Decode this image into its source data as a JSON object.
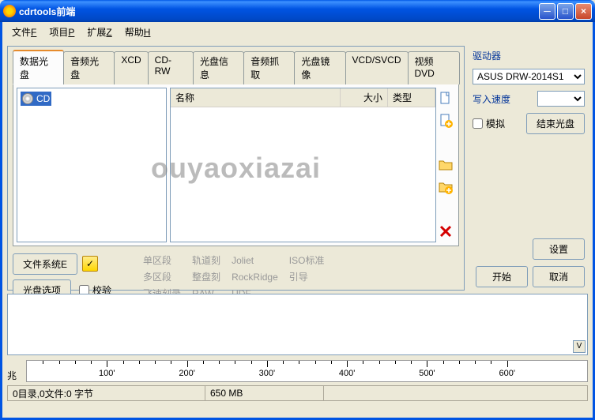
{
  "titlebar": {
    "title": "cdrtools前端"
  },
  "menu": {
    "file": "文件",
    "file_u": "F",
    "project": "项目",
    "project_u": "P",
    "extend": "扩展",
    "extend_u": "Z",
    "help": "帮助",
    "help_u": "H"
  },
  "tabs": [
    "数据光盘",
    "音频光盘",
    "XCD",
    "CD-RW",
    "光盘信息",
    "音频抓取",
    "光盘镜像",
    "VCD/SVCD",
    "视频DVD"
  ],
  "active_tab": 0,
  "tree": {
    "root": "CD"
  },
  "listcols": {
    "name": "名称",
    "size": "大小",
    "type": "类型"
  },
  "buttons": {
    "filesystem": "文件系统E",
    "discoptions": "光盘选项",
    "verify": "校验",
    "settings": "设置",
    "start": "开始",
    "cancel": "取消",
    "finalize": "结束光盘"
  },
  "info": {
    "r1c1": "单区段",
    "r1c2": "轨道刻",
    "r1c3": "Joliet",
    "r1c4": "ISO标准",
    "r2c1": "多区段",
    "r2c2": "整盘刻",
    "r2c3": "RockRidge",
    "r2c4": "引导",
    "r3c1": "飞速刻录",
    "r3c2": "RAW",
    "r3c3": "UDF"
  },
  "right": {
    "drive_label": "驱动器",
    "drive_value": "ASUS DRW-2014S1",
    "speed_label": "写入速度",
    "simulate": "模拟"
  },
  "ruler": {
    "unit": "兆",
    "ticks": [
      "100'",
      "200'",
      "300'",
      "400'",
      "500'",
      "600'"
    ]
  },
  "status": {
    "left": "0目录,0文件:0 字节",
    "mid": "650 MB"
  },
  "watermark": "ouyaoxiazai",
  "icons": {
    "doc": "doc-icon",
    "docadd": "doc-add-icon",
    "folder": "folder-icon",
    "folderadd": "folder-add-icon",
    "delete": "delete-icon"
  }
}
